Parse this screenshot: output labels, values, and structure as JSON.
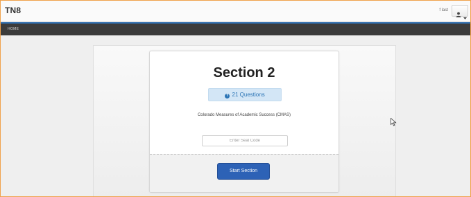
{
  "header": {
    "brand": "TN8",
    "user_name": "f last"
  },
  "nav": {
    "home_label": "HOME"
  },
  "section": {
    "title": "Section 2",
    "question_count_label": "21 Questions",
    "test_name": "Colorado Measures of Academic Success (CMAS)",
    "seal_code_placeholder": "Enter Seal Code",
    "start_button_label": "Start Section"
  },
  "icons": {
    "user": "user-icon",
    "caret": "caret-down-icon",
    "info": "info-circle-icon",
    "cursor": "mouse-cursor-icon"
  },
  "colors": {
    "accent_blue": "#2d62b6",
    "badge_background": "#d3e6f6",
    "nav_background": "#3b3b3b",
    "frame_border": "#f0a14a"
  }
}
